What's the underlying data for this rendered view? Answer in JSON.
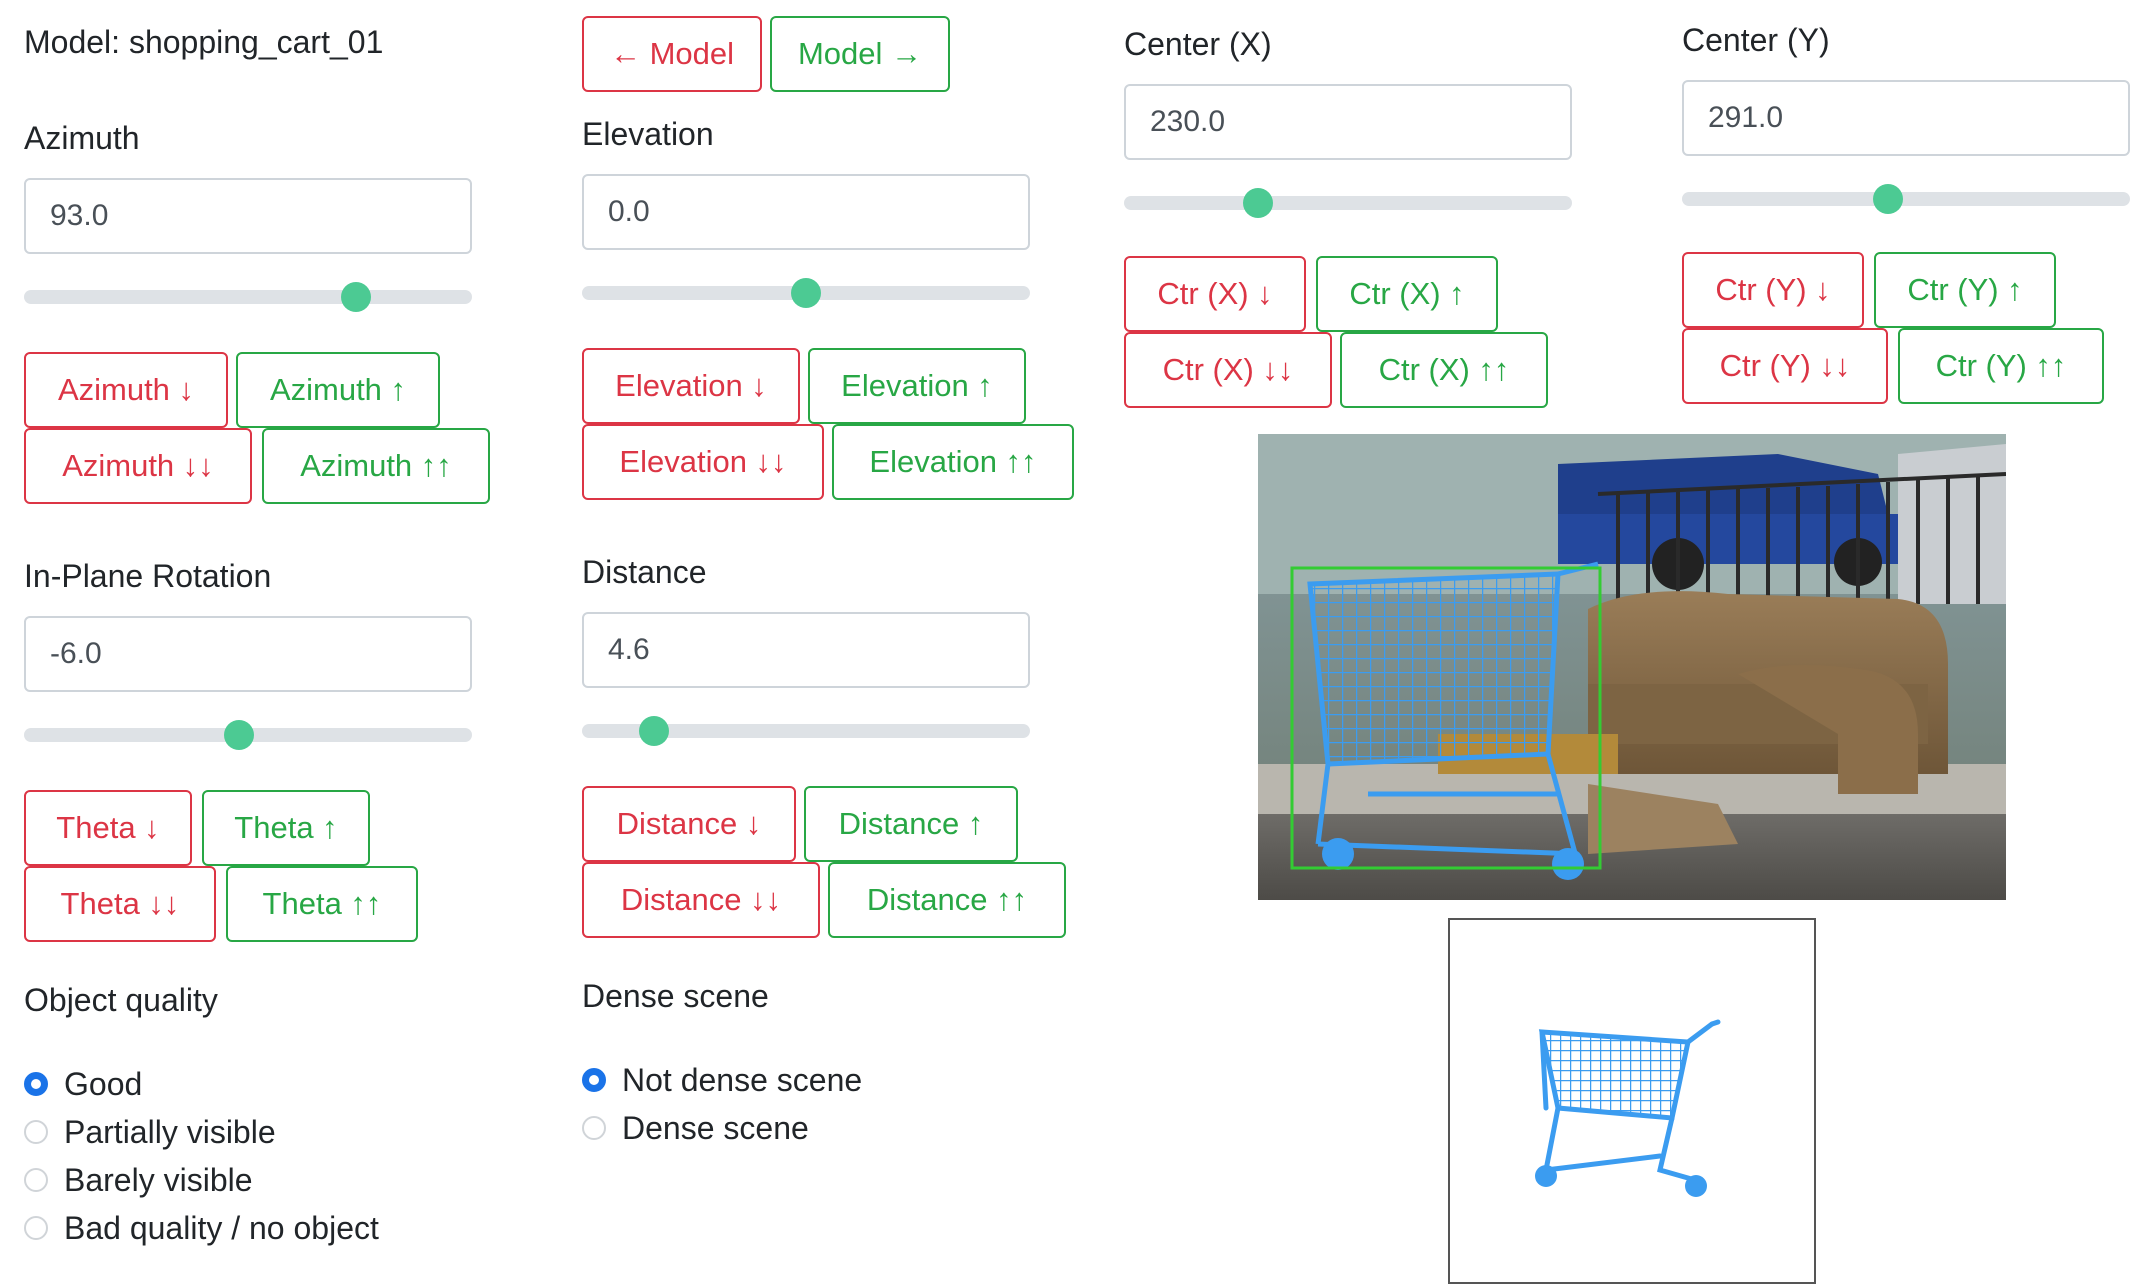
{
  "model_label": "Model: shopping_cart_01",
  "nav": {
    "prev": "← Model",
    "next": "Model →"
  },
  "azimuth": {
    "label": "Azimuth",
    "value": "93.0",
    "slider_fraction": 0.74,
    "buttons": [
      "Azimuth ↓",
      "Azimuth ↑",
      "Azimuth ↓↓",
      "Azimuth ↑↑"
    ]
  },
  "elevation": {
    "label": "Elevation",
    "value": "0.0",
    "slider_fraction": 0.5,
    "buttons": [
      "Elevation ↓",
      "Elevation ↑",
      "Elevation ↓↓",
      "Elevation ↑↑"
    ]
  },
  "center_x": {
    "label": "Center (X)",
    "value": "230.0",
    "slider_fraction": 0.3,
    "buttons": [
      "Ctr (X) ↓",
      "Ctr (X) ↑",
      "Ctr (X) ↓↓",
      "Ctr (X) ↑↑"
    ]
  },
  "center_y": {
    "label": "Center (Y)",
    "value": "291.0",
    "slider_fraction": 0.46,
    "buttons": [
      "Ctr (Y) ↓",
      "Ctr (Y) ↑",
      "Ctr (Y) ↓↓",
      "Ctr (Y) ↑↑"
    ]
  },
  "theta": {
    "label": "In-Plane Rotation",
    "value": "-6.0",
    "slider_fraction": 0.48,
    "buttons": [
      "Theta ↓",
      "Theta ↑",
      "Theta ↓↓",
      "Theta ↑↑"
    ]
  },
  "distance": {
    "label": "Distance",
    "value": "4.6",
    "slider_fraction": 0.16,
    "buttons": [
      "Distance ↓",
      "Distance ↑",
      "Distance ↓↓",
      "Distance ↑↑"
    ]
  },
  "object_quality": {
    "label": "Object quality",
    "options": [
      "Good",
      "Partially visible",
      "Barely visible",
      "Bad quality / no object"
    ],
    "selected": "Good"
  },
  "dense_scene": {
    "label": "Dense scene",
    "options": [
      "Not dense scene",
      "Dense scene"
    ],
    "selected": "Not dense scene"
  },
  "colors": {
    "danger": "#dc3545",
    "success": "#28a745",
    "slider_thumb": "#4cca93",
    "radio_selected": "#1a73e8",
    "overlay_blue": "#3b9cf0",
    "bbox_green": "#33cc33"
  },
  "icons": {
    "photo": "scene-photo",
    "preview": "cart-model-render"
  }
}
